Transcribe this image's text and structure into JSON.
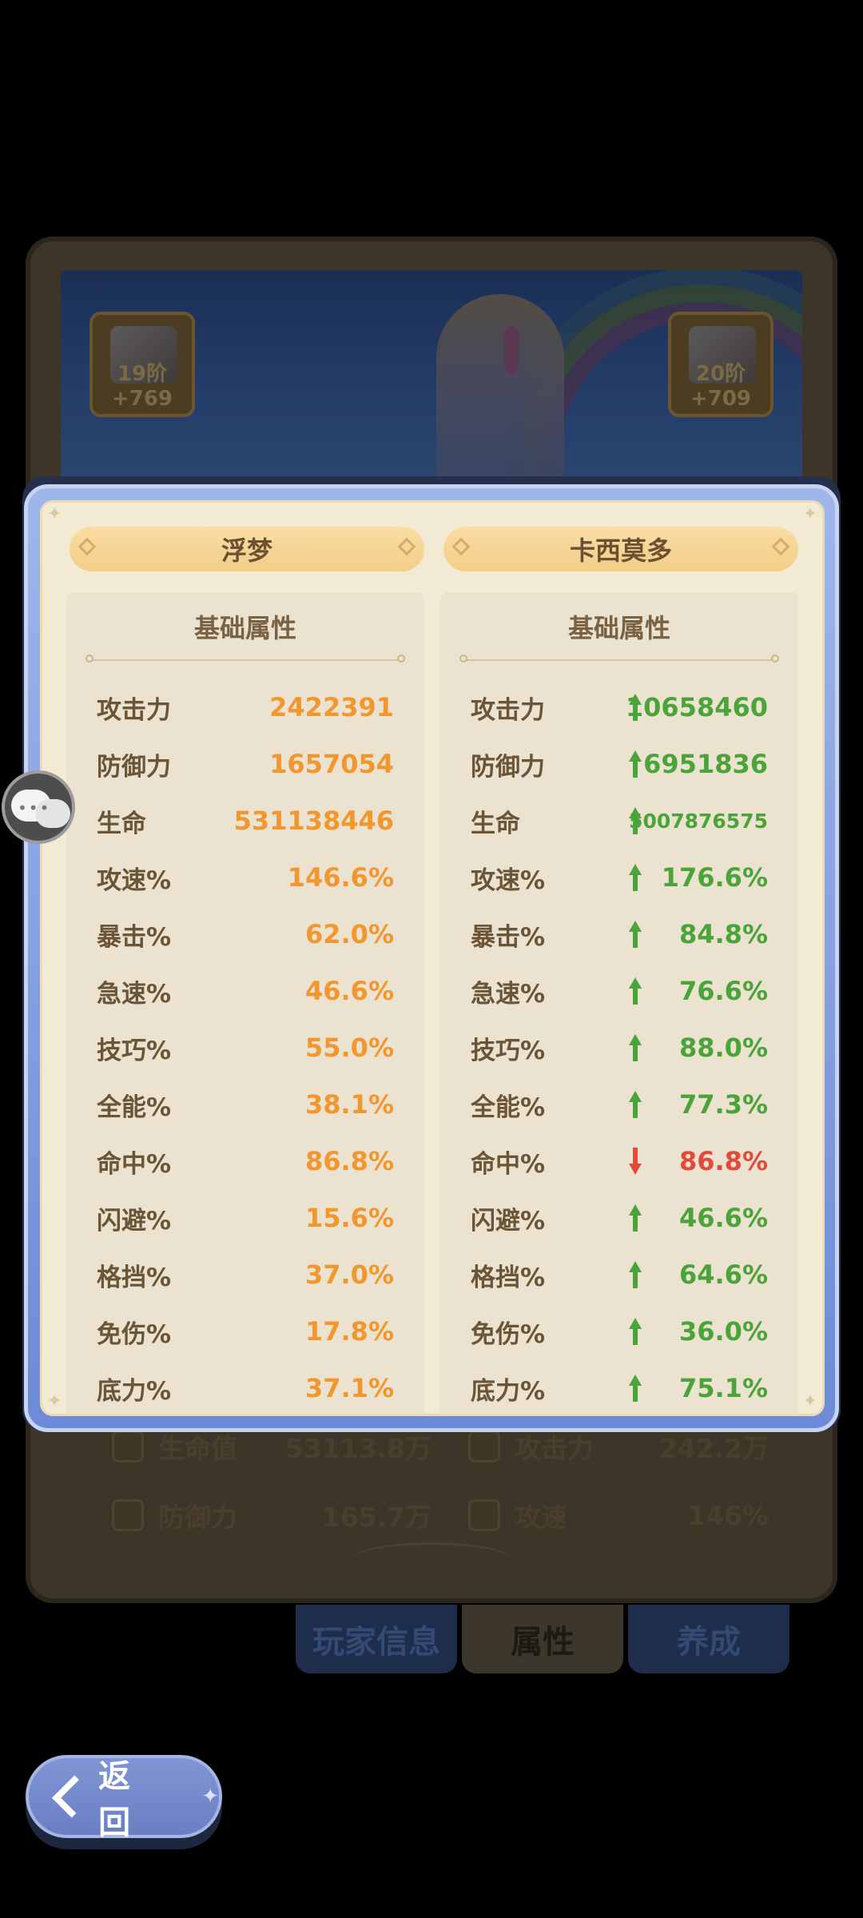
{
  "background": {
    "equip_left_level": "19阶+769",
    "equip_right_level": "20阶+709",
    "stats": [
      {
        "label": "生命值",
        "value": "53113.8万"
      },
      {
        "label": "攻击力",
        "value": "242.2万"
      },
      {
        "label": "防御力",
        "value": "165.7万"
      },
      {
        "label": "攻速",
        "value": "146%"
      }
    ],
    "tabs": [
      "玩家信息",
      "属性",
      "养成"
    ],
    "back_label": "返 回"
  },
  "compare": {
    "left": {
      "name": "浮梦",
      "section_title": "基础属性",
      "stats": [
        {
          "label": "攻击力",
          "value": "2422391"
        },
        {
          "label": "防御力",
          "value": "1657054"
        },
        {
          "label": "生命",
          "value": "531138446"
        },
        {
          "label": "攻速%",
          "value": "146.6%"
        },
        {
          "label": "暴击%",
          "value": "62.0%"
        },
        {
          "label": "急速%",
          "value": "46.6%"
        },
        {
          "label": "技巧%",
          "value": "55.0%"
        },
        {
          "label": "全能%",
          "value": "38.1%"
        },
        {
          "label": "命中%",
          "value": "86.8%"
        },
        {
          "label": "闪避%",
          "value": "15.6%"
        },
        {
          "label": "格挡%",
          "value": "37.0%"
        },
        {
          "label": "免伤%",
          "value": "17.8%"
        },
        {
          "label": "底力%",
          "value": "37.1%"
        }
      ]
    },
    "right": {
      "name": "卡西莫多",
      "section_title": "基础属性",
      "stats": [
        {
          "label": "攻击力",
          "value": "10658460",
          "trend": "up"
        },
        {
          "label": "防御力",
          "value": "6951836",
          "trend": "up"
        },
        {
          "label": "生命",
          "value": "5007876575",
          "trend": "up"
        },
        {
          "label": "攻速%",
          "value": "176.6%",
          "trend": "up"
        },
        {
          "label": "暴击%",
          "value": "84.8%",
          "trend": "up"
        },
        {
          "label": "急速%",
          "value": "76.6%",
          "trend": "up"
        },
        {
          "label": "技巧%",
          "value": "88.0%",
          "trend": "up"
        },
        {
          "label": "全能%",
          "value": "77.3%",
          "trend": "up"
        },
        {
          "label": "命中%",
          "value": "86.8%",
          "trend": "down"
        },
        {
          "label": "闪避%",
          "value": "46.6%",
          "trend": "up"
        },
        {
          "label": "格挡%",
          "value": "64.6%",
          "trend": "up"
        },
        {
          "label": "免伤%",
          "value": "36.0%",
          "trend": "up"
        },
        {
          "label": "底力%",
          "value": "75.1%",
          "trend": "up"
        }
      ]
    }
  },
  "colors": {
    "left_value": "#f2962e",
    "up": "#4aa43a",
    "down": "#e24b3b"
  },
  "icons": [
    "chat-bubble-icon",
    "arrow-up-icon",
    "arrow-down-icon",
    "back-arrow-icon"
  ]
}
